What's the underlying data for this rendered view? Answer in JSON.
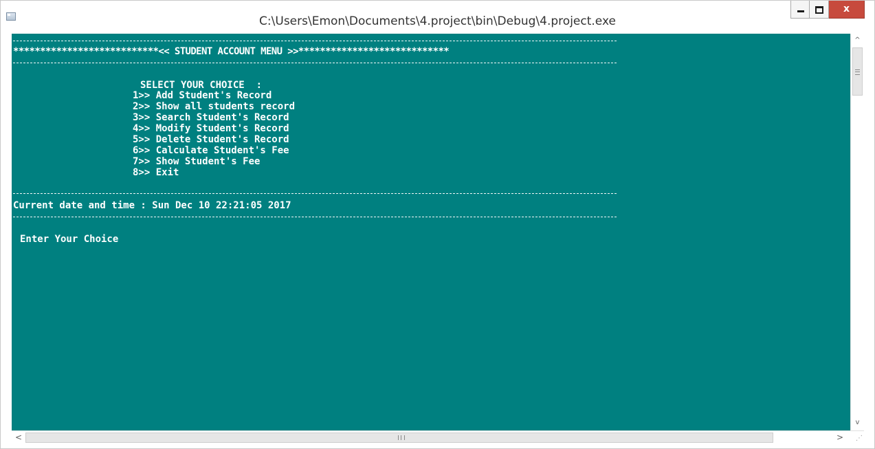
{
  "window": {
    "title": "C:\\Users\\Emon\\Documents\\4.project\\bin\\Debug\\4.project.exe",
    "close_glyph": "x",
    "icons": [
      "console-app-icon",
      "minimize-icon",
      "maximize-icon",
      "close-icon"
    ]
  },
  "console": {
    "background_color": "#008080",
    "text_color": "#ffffff",
    "header": "***************************<< STUDENT ACCOUNT MENU >>****************************",
    "select_prompt": "SELECT YOUR CHOICE  :",
    "menu_items": [
      "1>> Add Student's Record",
      "2>> Show all students record",
      "3>> Search Student's Record",
      "4>> Modify Student's Record",
      "5>> Delete Student's Record",
      "6>> Calculate Student's Fee",
      "7>> Show Student's Fee",
      "8>> Exit"
    ],
    "datetime_line": "Current date and time : Sun Dec 10 22:21:05 2017",
    "enter_prompt": "Enter Your Choice"
  },
  "scrollbars": {
    "up_arrow": "^",
    "down_arrow": "v",
    "left_arrow": "<",
    "right_arrow": ">"
  }
}
